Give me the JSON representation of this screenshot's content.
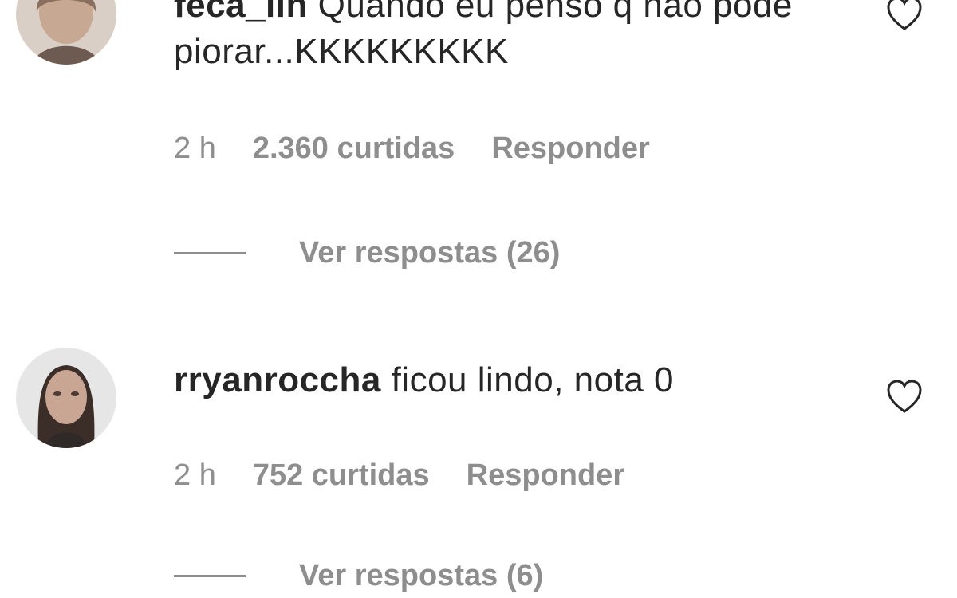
{
  "comments": [
    {
      "username": "feca_lin",
      "text": " Quando eu penso q não pode piorar...KKKKKKKKK",
      "time": "2 h",
      "likes": "2.360 curtidas",
      "reply_label": "Responder",
      "view_replies": "Ver respostas (26)",
      "avatar_icon": "user-avatar-photo",
      "like_icon": "heart-outline-icon"
    },
    {
      "username": "rryanroccha",
      "text": " ficou lindo, nota 0",
      "time": "2 h",
      "likes": "752 curtidas",
      "reply_label": "Responder",
      "view_replies": "Ver respostas (6)",
      "avatar_icon": "user-avatar-photo",
      "like_icon": "heart-outline-icon"
    }
  ],
  "colors": {
    "text": "#262626",
    "secondary": "#8e8e8e",
    "background": "#ffffff"
  }
}
